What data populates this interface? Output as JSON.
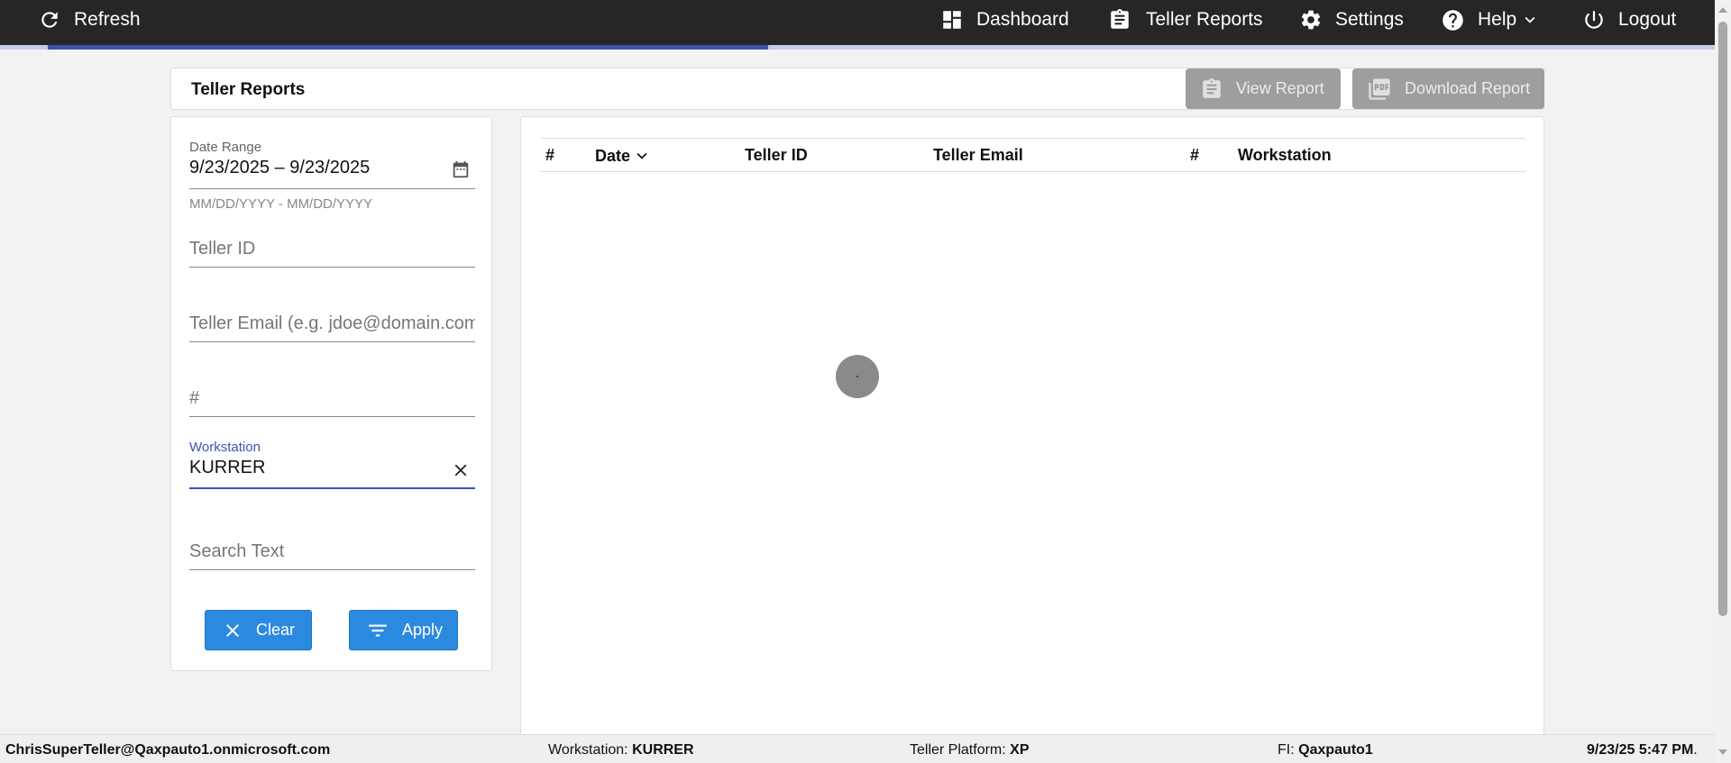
{
  "topbar": {
    "refresh": "Refresh",
    "dashboard": "Dashboard",
    "teller_reports": "Teller Reports",
    "settings": "Settings",
    "help": "Help",
    "logout": "Logout"
  },
  "page": {
    "title": "Teller Reports",
    "view_report": "View Report",
    "download_report": "Download Report"
  },
  "filters": {
    "date_range_label": "Date Range",
    "date_range_value": "9/23/2025 – 9/23/2025",
    "date_range_hint": "MM/DD/YYYY - MM/DD/YYYY",
    "teller_id_placeholder": "Teller ID",
    "teller_email_placeholder": "Teller Email (e.g. jdoe@domain.com)",
    "number_placeholder": "#",
    "workstation_label": "Workstation",
    "workstation_value": "KURRER",
    "search_text_placeholder": "Search Text",
    "clear_label": "Clear",
    "apply_label": "Apply"
  },
  "table": {
    "columns": [
      "#",
      "Date",
      "Teller ID",
      "Teller Email",
      "#",
      "Workstation"
    ],
    "rows": []
  },
  "footer": {
    "user": "ChrisSuperTeller@Qaxpauto1.onmicrosoft.com",
    "workstation_label": "Workstation:",
    "workstation_value": "KURRER",
    "platform_label": "Teller Platform:",
    "platform_value": "XP",
    "fi_label": "FI:",
    "fi_value": "Qaxpauto1",
    "datetime": "9/23/25 5:47 PM",
    "datetime_suffix": "."
  },
  "colors": {
    "topbar": "#262626",
    "accent": "#3f51b5",
    "primary_button": "#2b8ae0",
    "disabled_button": "#9e9e9e"
  },
  "icons": [
    "refresh-icon",
    "dashboard-icon",
    "clipboard-icon",
    "gear-icon",
    "help-icon",
    "chevron-down-icon",
    "power-icon",
    "calendar-icon",
    "close-icon",
    "filter-icon",
    "pdf-icon",
    "sort-chevron-icon"
  ],
  "loading_progress": 0.42
}
